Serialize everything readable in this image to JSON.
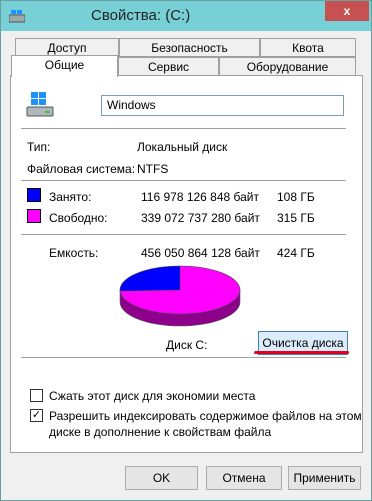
{
  "window": {
    "title": "Свойства: (C:)",
    "close_label": "x"
  },
  "tabs_row1": [
    "Доступ",
    "Безопасность",
    "Квота"
  ],
  "tabs_row2": [
    "Общие",
    "Сервис",
    "Оборудование"
  ],
  "volume": {
    "name": "Windows"
  },
  "info": {
    "type_label": "Тип:",
    "type_value": "Локальный диск",
    "fs_label": "Файловая система:",
    "fs_value": "NTFS"
  },
  "used": {
    "label": "Занято:",
    "bytes": "116 978 126 848 байт",
    "size": "108 ГБ",
    "color": "#0000ff"
  },
  "free": {
    "label": "Свободно:",
    "bytes": "339 072 737 280 байт",
    "size": "315 ГБ",
    "color": "#ff00ff"
  },
  "capacity": {
    "label": "Емкость:",
    "bytes": "456 050 864 128 байт",
    "size": "424 ГБ"
  },
  "disk_label": "Диск C:",
  "cleanup_button": "Очистка диска",
  "options": {
    "compress_label": "Сжать этот диск для экономии места",
    "compress_checked": false,
    "index_label_line1": "Разрешить индексировать содержимое файлов на этом",
    "index_label_line2": "диске в дополнение к свойствам файла",
    "index_checked": true
  },
  "buttons": {
    "ok": "OK",
    "cancel": "Отмена",
    "apply": "Применить"
  },
  "chart_data": {
    "type": "pie",
    "categories": [
      "Занято",
      "Свободно"
    ],
    "values": [
      116978126848,
      339072737280
    ],
    "colors": [
      "#0000ff",
      "#ff00ff"
    ]
  }
}
